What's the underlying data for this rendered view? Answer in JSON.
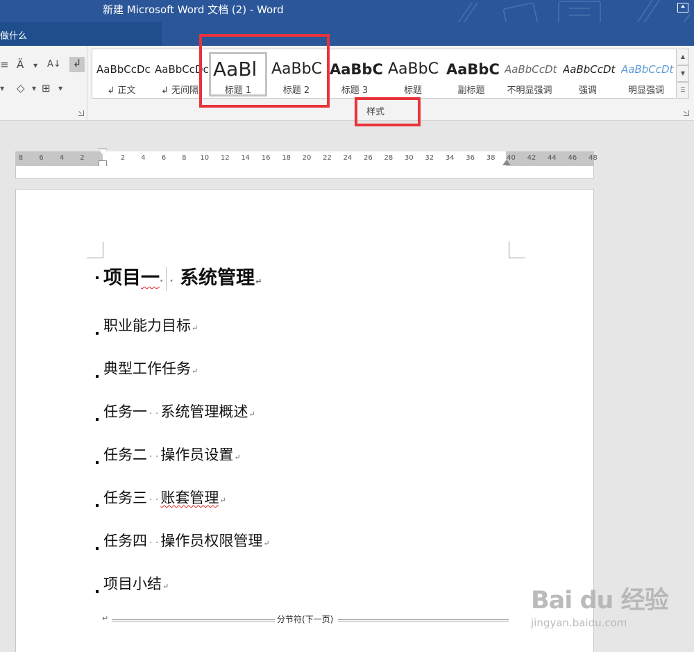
{
  "window": {
    "title": "新建 Microsoft Word 文档 (2)  -  Word"
  },
  "tellme": {
    "label": "做什么"
  },
  "paragraph_group": {
    "icons": [
      "list-icon",
      "text-direction-icon",
      "sort-icon",
      "paragraph-mark-icon",
      "shading-icon",
      "borders-icon"
    ]
  },
  "styles_group": {
    "label": "样式",
    "items": [
      {
        "preview": "AaBbCcDc",
        "label": "↲ 正文"
      },
      {
        "preview": "AaBbCcDc",
        "label": "↲ 无间隔"
      },
      {
        "preview": "AaBl",
        "label": "标题 1"
      },
      {
        "preview": "AaBbC",
        "label": "标题 2"
      },
      {
        "preview": "AaBbC",
        "label": "标题 3"
      },
      {
        "preview": "AaBbC",
        "label": "标题"
      },
      {
        "preview": "AaBbC",
        "label": "副标题"
      },
      {
        "preview": "AaBbCcDt",
        "label": "不明显强调"
      },
      {
        "preview": "AaBbCcDt",
        "label": "强调"
      },
      {
        "preview": "AaBbCcDt",
        "label": "明显强调"
      }
    ]
  },
  "ruler": {
    "ticks": [
      "8",
      "6",
      "4",
      "2",
      "2",
      "4",
      "6",
      "8",
      "10",
      "12",
      "14",
      "16",
      "18",
      "20",
      "22",
      "24",
      "26",
      "28",
      "30",
      "32",
      "34",
      "36",
      "38",
      "40",
      "42",
      "44",
      "46",
      "48"
    ]
  },
  "document": {
    "heading": {
      "part1": "项目一",
      "part2": "系统管理"
    },
    "lines": [
      {
        "a": "职业能力目标"
      },
      {
        "a": "典型工作任务"
      },
      {
        "a": "任务一",
        "b": "系统管理概述"
      },
      {
        "a": "任务二",
        "b": "操作员设置"
      },
      {
        "a": "任务三",
        "b": "账套管理"
      },
      {
        "a": "任务四",
        "b": "操作员权限管理"
      },
      {
        "a": "项目小结"
      }
    ],
    "section_break": "分节符(下一页)"
  },
  "watermark": {
    "main": "Bai du 经验",
    "sub": "jingyan.baidu.com"
  }
}
